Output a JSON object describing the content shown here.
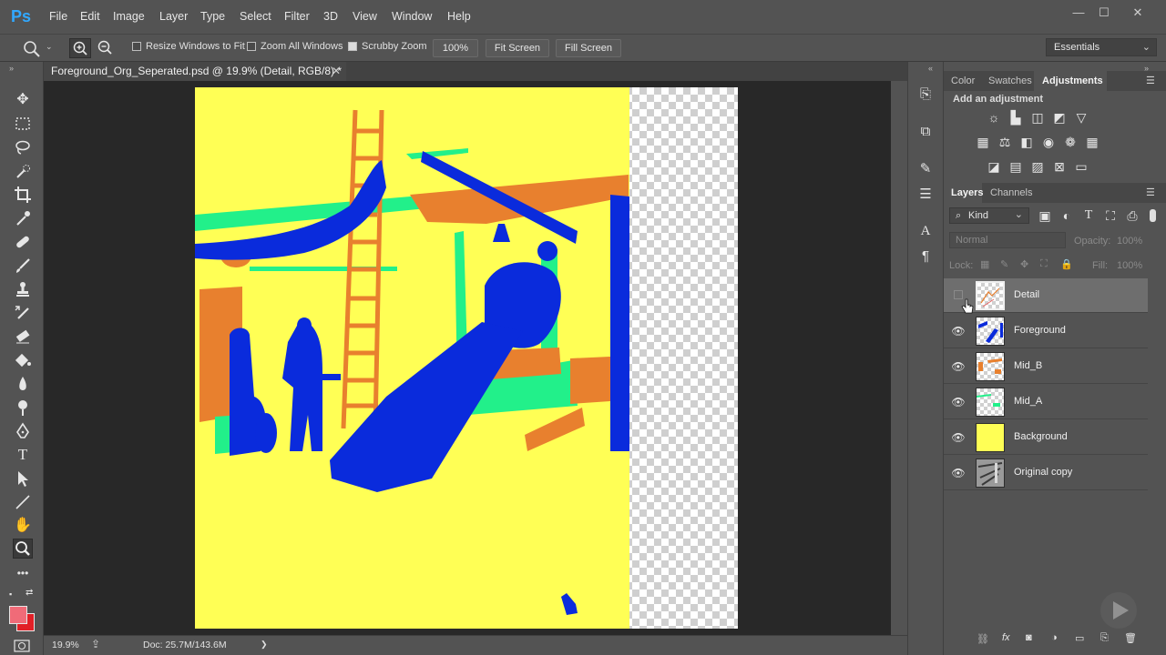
{
  "app": {
    "logo": "Ps"
  },
  "menu": [
    "File",
    "Edit",
    "Image",
    "Layer",
    "Type",
    "Select",
    "Filter",
    "3D",
    "View",
    "Window",
    "Help"
  ],
  "window_controls": {
    "minimize": "—",
    "maximize": "☐",
    "close": "✕"
  },
  "options": {
    "resize_windows": "Resize Windows to Fit",
    "zoom_all": "Zoom All Windows",
    "scrubby_zoom": "Scrubby Zoom",
    "zoom_value": "100%",
    "fit_screen": "Fit Screen",
    "fill_screen": "Fill Screen",
    "workspace": "Essentials"
  },
  "document": {
    "tab_title": "Foreground_Org_Seperated.psd @ 19.9% (Detail, RGB/8) *",
    "close": "✕"
  },
  "status": {
    "zoom": "19.9%",
    "doc": "Doc: 25.7M/143.6M",
    "arrow": "❯"
  },
  "panels": {
    "top_tabs": [
      "Color",
      "Swatches",
      "Adjustments"
    ],
    "add_adjustment": "Add an adjustment",
    "layer_tabs": [
      "Layers",
      "Channels"
    ],
    "kind": "Kind",
    "blend_mode": "Normal",
    "opacity_label": "Opacity:",
    "opacity_value": "100%",
    "lock_label": "Lock:",
    "fill_label": "Fill:",
    "fill_value": "100%"
  },
  "layers": [
    {
      "name": "Detail",
      "visible": false,
      "selected": true
    },
    {
      "name": "Foreground",
      "visible": true,
      "selected": false
    },
    {
      "name": "Mid_B",
      "visible": true,
      "selected": false
    },
    {
      "name": "Mid_A",
      "visible": true,
      "selected": false
    },
    {
      "name": "Background",
      "visible": true,
      "selected": false
    },
    {
      "name": "Original copy",
      "visible": true,
      "selected": false
    }
  ],
  "colors": {
    "foreground_swatch": "#f06b78",
    "background_swatch": "#e11f26",
    "yellow": "#ffff55",
    "blue": "#0a2bdc",
    "orange": "#e8802e",
    "green": "#22f08a"
  },
  "icons": {
    "move": "move-icon",
    "marquee": "marquee-icon",
    "lasso": "lasso-icon",
    "quick-select": "quick-select-icon",
    "crop": "crop-icon",
    "eyedropper": "eyedropper-icon",
    "healing": "healing-icon",
    "brush": "brush-icon",
    "stamp": "stamp-icon",
    "history-brush": "history-brush-icon",
    "eraser": "eraser-icon",
    "bucket": "paint-bucket-icon",
    "blur": "blur-icon",
    "dodge": "dodge-icon",
    "pen": "pen-icon",
    "type": "type-icon",
    "path-select": "path-select-icon",
    "line": "line-icon",
    "hand": "hand-icon",
    "zoom": "zoom-icon"
  }
}
